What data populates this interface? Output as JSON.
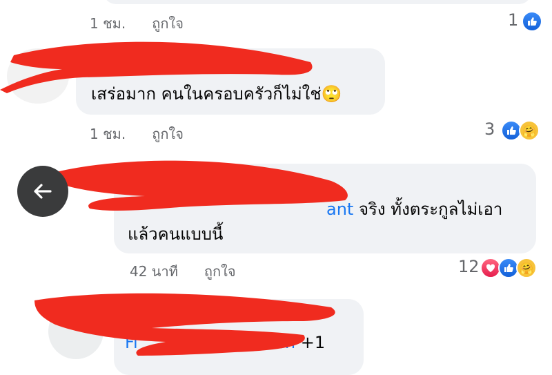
{
  "comments": [
    {
      "time": "1 ชม.",
      "like_action": "ถูกใจ",
      "reaction_count": "1",
      "reactions": [
        "like-icon"
      ]
    },
    {
      "text": "เสร่อมาก คนในครอบครัวก็ไม่ใช่",
      "emoji": "🙄",
      "time": "1 ชม.",
      "like_action": "ถูกใจ",
      "reaction_count": "3",
      "reactions": [
        "like-icon",
        "care-icon"
      ]
    },
    {
      "mention_fragment": "ant",
      "text_line1": " จริง ทั้งตระกูลไม่เอา",
      "text_line2": "แล้วคนแบบนี้",
      "time": "42 นาที",
      "like_action": "ถูกใจ",
      "reaction_count": "12",
      "reactions": [
        "love-icon",
        "like-icon",
        "care-icon"
      ]
    },
    {
      "mention_prefix": "Fi",
      "mention_suffix": "ch",
      "more_count": " +1"
    }
  ],
  "colors": {
    "bubble": "#f0f2f5",
    "meta_text": "#65676b",
    "mention": "#1877f2",
    "redaction": "#f02b1f",
    "like": "#1877f2",
    "love": "#f33e58",
    "care": "#f7b125"
  },
  "back_button": {
    "icon": "arrow-left-icon"
  }
}
